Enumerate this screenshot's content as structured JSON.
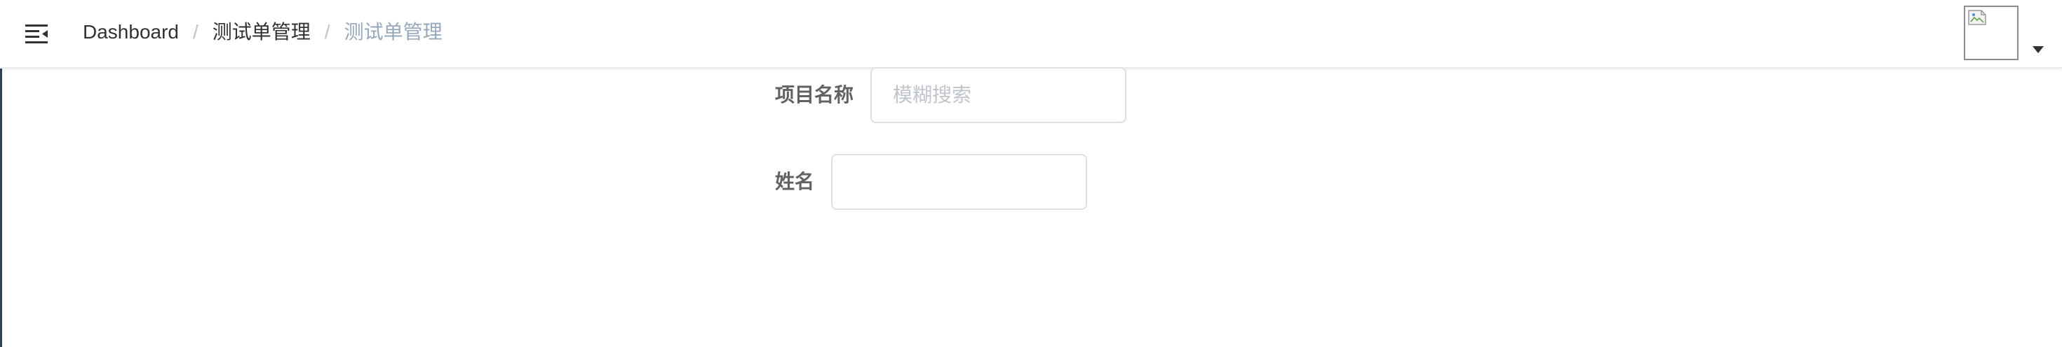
{
  "navbar": {
    "breadcrumb": [
      {
        "label": "Dashboard"
      },
      {
        "label": "测试单管理"
      },
      {
        "label": "测试单管理"
      }
    ],
    "separator": "/",
    "hamburger_icon": "menu-fold-icon",
    "avatar_icon": "broken-image-icon",
    "dropdown_icon": "caret-down-icon"
  },
  "filters": {
    "project_name": {
      "label": "项目名称",
      "value": "",
      "placeholder": "模糊搜索"
    },
    "name": {
      "label": "姓名",
      "value": "",
      "placeholder": ""
    }
  },
  "colors": {
    "sidebar": "#304156",
    "breadcrumb_active": "#303133",
    "breadcrumb_current": "#97a8be",
    "input_border": "#dcdfe6",
    "placeholder": "#c0c4cc"
  }
}
